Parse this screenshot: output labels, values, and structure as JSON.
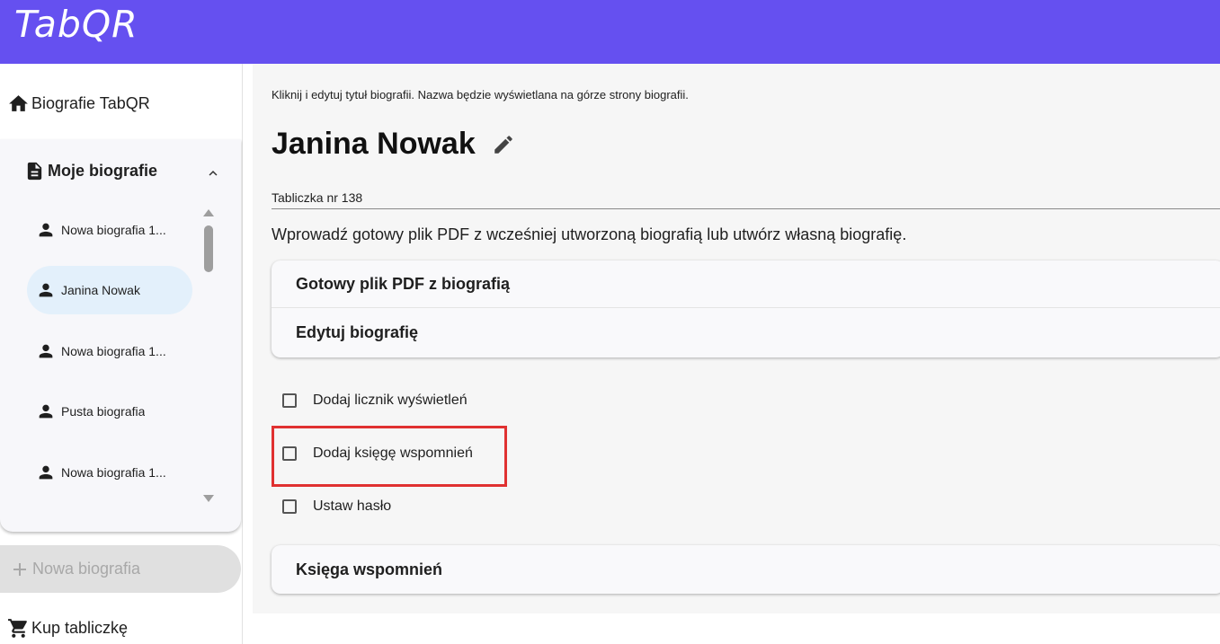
{
  "app": {
    "brand": "TabQR"
  },
  "sidebar": {
    "home_label": "Biografie TabQR",
    "my_bios": {
      "title": "Moje biografie",
      "items": [
        {
          "label": "Nowa biografia 1..."
        },
        {
          "label": "Janina Nowak"
        },
        {
          "label": "Nowa biografia 1..."
        },
        {
          "label": "Pusta biografia"
        },
        {
          "label": "Nowa biografia 1..."
        }
      ]
    },
    "new_bio_label": "Nowa biografia",
    "buy_label": "Kup tabliczkę"
  },
  "main": {
    "hint": "Kliknij i edytuj tytuł biografii. Nazwa będzie wyświetlana na górze strony biografii.",
    "title": "Janina Nowak",
    "plate_value": "Tabliczka nr 138",
    "instruction": "Wprowadź gotowy plik PDF z wcześniej utworzoną biografią lub utwórz własną biografię.",
    "accordion": [
      {
        "label": "Gotowy plik PDF z biografią"
      },
      {
        "label": "Edytuj biografię"
      }
    ],
    "options": [
      {
        "label": "Dodaj licznik wyświetleń",
        "checked": false
      },
      {
        "label": "Dodaj księgę wspomnień",
        "checked": false
      },
      {
        "label": "Ustaw hasło",
        "checked": false
      }
    ],
    "guestbook_label": "Księga wspomnień"
  },
  "colors": {
    "topbar": "#6550f0",
    "selected_item": "#e3f0fb",
    "highlight": "#e03131"
  }
}
